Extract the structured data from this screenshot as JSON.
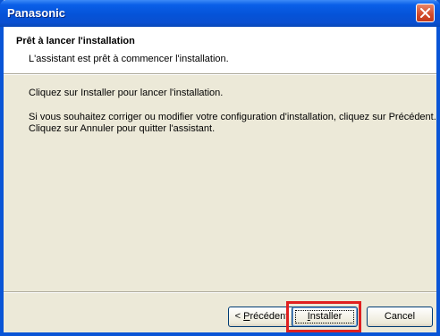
{
  "window": {
    "title": "Panasonic"
  },
  "header": {
    "title": "Prêt à lancer l'installation",
    "subtitle": "L'assistant est prêt à commencer l'installation."
  },
  "body": {
    "line1": "Cliquez sur Installer pour lancer l'installation.",
    "line2": "Si vous souhaitez corriger ou modifier votre configuration d'installation, cliquez sur Précédent.",
    "line3": "Cliquez sur Annuler pour quitter l'assistant."
  },
  "buttons": {
    "back_prefix": "< ",
    "back_mnemonic": "P",
    "back_rest": "récédent",
    "install_mnemonic": "I",
    "install_rest": "nstaller",
    "cancel": "Cancel"
  },
  "colors": {
    "titlebar": "#0553d8",
    "highlight": "#e02020",
    "dialog_bg": "#ece9d8"
  }
}
